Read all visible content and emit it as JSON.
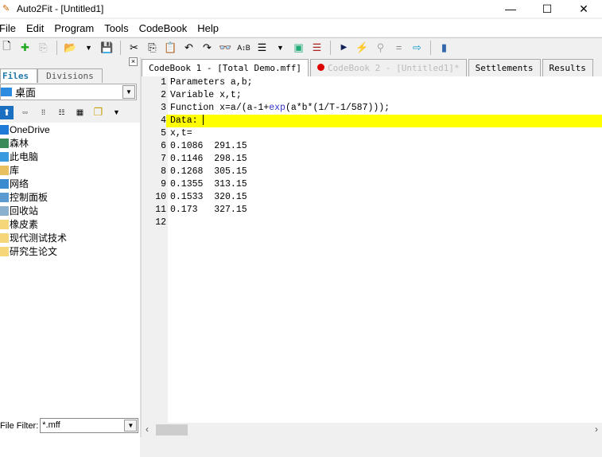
{
  "window": {
    "title": "Auto2Fit - [Untitled1]"
  },
  "menu": [
    "File",
    "Edit",
    "Program",
    "Tools",
    "CodeBook",
    "Help"
  ],
  "left_panel": {
    "tabs": [
      "Files",
      "Divisions"
    ],
    "drive": "桌面",
    "items": [
      {
        "label": "OneDrive",
        "color": "#1e7ad6"
      },
      {
        "label": "森林",
        "color": "#3a8a5a"
      },
      {
        "label": "此电脑",
        "color": "#3a9ae0"
      },
      {
        "label": "库",
        "color": "#e8c060"
      },
      {
        "label": "网络",
        "color": "#3a8ad0"
      },
      {
        "label": "控制面板",
        "color": "#5a9ad0"
      },
      {
        "label": "回收站",
        "color": "#8ab0d0"
      },
      {
        "label": "橡皮素",
        "color": "#f5d77a"
      },
      {
        "label": "现代测试技术",
        "color": "#f5d77a"
      },
      {
        "label": "研究生论文",
        "color": "#f5d77a"
      }
    ],
    "file_filter_label": "File Filter:",
    "file_filter_value": "*.mff"
  },
  "tabs": [
    {
      "label": "CodeBook 1 - [Total Demo.mff]"
    },
    {
      "label": "CodeBook 2 - [Untitled1]*"
    },
    {
      "label": "Settlements"
    },
    {
      "label": "Results"
    }
  ],
  "editor": {
    "lines": [
      {
        "n": "1",
        "pre": "Parameters a,b;"
      },
      {
        "n": "2",
        "pre": "Variable x,t;"
      },
      {
        "n": "3",
        "pre": "Function x=a/(a-1+",
        "kw": "exp",
        "post": "(a*b*(1/T-1/587)));"
      },
      {
        "n": "4",
        "pre": "Data: "
      },
      {
        "n": "5",
        "pre": "x,t="
      },
      {
        "n": "6",
        "pre": "0.1086  291.15"
      },
      {
        "n": "7",
        "pre": "0.1146  298.15"
      },
      {
        "n": "8",
        "pre": "0.1268  305.15"
      },
      {
        "n": "9",
        "pre": "0.1355  313.15"
      },
      {
        "n": "10",
        "pre": "0.1533  320.15"
      },
      {
        "n": "11",
        "pre": "0.173   327.15"
      },
      {
        "n": "12",
        "pre": ""
      }
    ]
  }
}
